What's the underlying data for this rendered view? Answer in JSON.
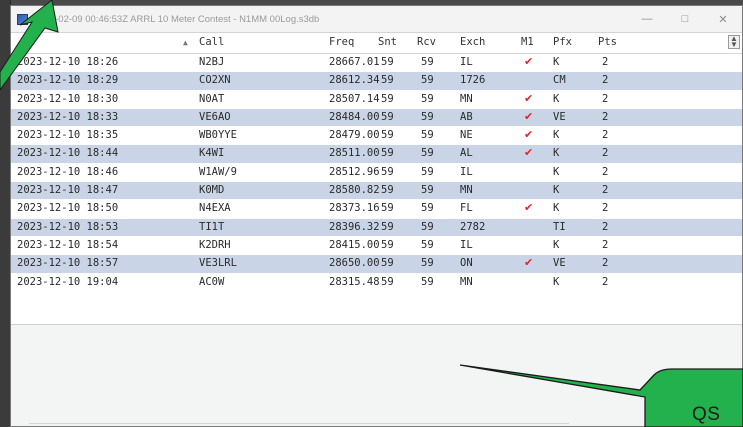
{
  "window": {
    "title": "2024-02-09 00:46:53Z  ARRL 10 Meter Contest - N1MM 00Log.s3db",
    "minimize_icon": "minimize-icon",
    "maximize_icon": "maximize-icon",
    "close_icon": "close-icon"
  },
  "grid": {
    "sort_indicator": "▲",
    "headers": {
      "time": "",
      "call": "Call",
      "freq": "Freq",
      "snt": "Snt",
      "rcv": "Rcv",
      "exch": "Exch",
      "m1": "M1",
      "pfx": "Pfx",
      "pts": "Pts"
    },
    "rows": [
      {
        "time": "2023-12-10 18:26",
        "call": "N2BJ",
        "freq": "28667.01",
        "snt": "59",
        "rcv": "59",
        "exch": "IL",
        "m1": true,
        "pfx": "K",
        "pts": "2"
      },
      {
        "time": "2023-12-10 18:29",
        "call": "CO2XN",
        "freq": "28612.34",
        "snt": "59",
        "rcv": "59",
        "exch": "1726",
        "m1": false,
        "pfx": "CM",
        "pts": "2"
      },
      {
        "time": "2023-12-10 18:30",
        "call": "N0AT",
        "freq": "28507.14",
        "snt": "59",
        "rcv": "59",
        "exch": "MN",
        "m1": true,
        "pfx": "K",
        "pts": "2"
      },
      {
        "time": "2023-12-10 18:33",
        "call": "VE6AO",
        "freq": "28484.00",
        "snt": "59",
        "rcv": "59",
        "exch": "AB",
        "m1": true,
        "pfx": "VE",
        "pts": "2"
      },
      {
        "time": "2023-12-10 18:35",
        "call": "WB0YYE",
        "freq": "28479.00",
        "snt": "59",
        "rcv": "59",
        "exch": "NE",
        "m1": true,
        "pfx": "K",
        "pts": "2"
      },
      {
        "time": "2023-12-10 18:44",
        "call": "K4WI",
        "freq": "28511.00",
        "snt": "59",
        "rcv": "59",
        "exch": "AL",
        "m1": true,
        "pfx": "K",
        "pts": "2"
      },
      {
        "time": "2023-12-10 18:46",
        "call": "W1AW/9",
        "freq": "28512.96",
        "snt": "59",
        "rcv": "59",
        "exch": "IL",
        "m1": false,
        "pfx": "K",
        "pts": "2"
      },
      {
        "time": "2023-12-10 18:47",
        "call": "K0MD",
        "freq": "28580.82",
        "snt": "59",
        "rcv": "59",
        "exch": "MN",
        "m1": false,
        "pfx": "K",
        "pts": "2"
      },
      {
        "time": "2023-12-10 18:50",
        "call": "N4EXA",
        "freq": "28373.16",
        "snt": "59",
        "rcv": "59",
        "exch": "FL",
        "m1": true,
        "pfx": "K",
        "pts": "2"
      },
      {
        "time": "2023-12-10 18:53",
        "call": "TI1T",
        "freq": "28396.32",
        "snt": "59",
        "rcv": "59",
        "exch": "2782",
        "m1": false,
        "pfx": "TI",
        "pts": "2"
      },
      {
        "time": "2023-12-10 18:54",
        "call": "K2DRH",
        "freq": "28415.00",
        "snt": "59",
        "rcv": "59",
        "exch": "IL",
        "m1": false,
        "pfx": "K",
        "pts": "2"
      },
      {
        "time": "2023-12-10 18:57",
        "call": "VE3LRL",
        "freq": "28650.00",
        "snt": "59",
        "rcv": "59",
        "exch": "ON",
        "m1": true,
        "pfx": "VE",
        "pts": "2"
      },
      {
        "time": "2023-12-10 19:04",
        "call": "AC0W",
        "freq": "28315.48",
        "snt": "59",
        "rcv": "59",
        "exch": "MN",
        "m1": false,
        "pfx": "K",
        "pts": "2"
      }
    ]
  },
  "annotation": {
    "callout_text": "QS",
    "callout_color": "#22b14c",
    "check_color": "#e0262b",
    "alt_row_color": "#c9d5e7"
  }
}
